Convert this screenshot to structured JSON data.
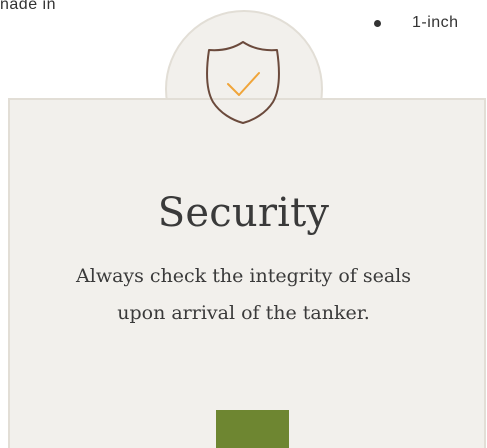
{
  "top_left_text": "nade in",
  "bullet_list": {
    "items": [
      "1-inch"
    ]
  },
  "card": {
    "icon": "shield-check-icon",
    "title": "Security",
    "description": "Always check the integrity of seals upon arrival of the tanker.",
    "button_label": ""
  },
  "colors": {
    "card_background": "#f2f0ec",
    "card_border": "#e2ded6",
    "shield_stroke": "#6b4a3c",
    "check_color": "#f0a53a",
    "button_color": "#6e8631",
    "text_color": "#3a3a3a"
  }
}
